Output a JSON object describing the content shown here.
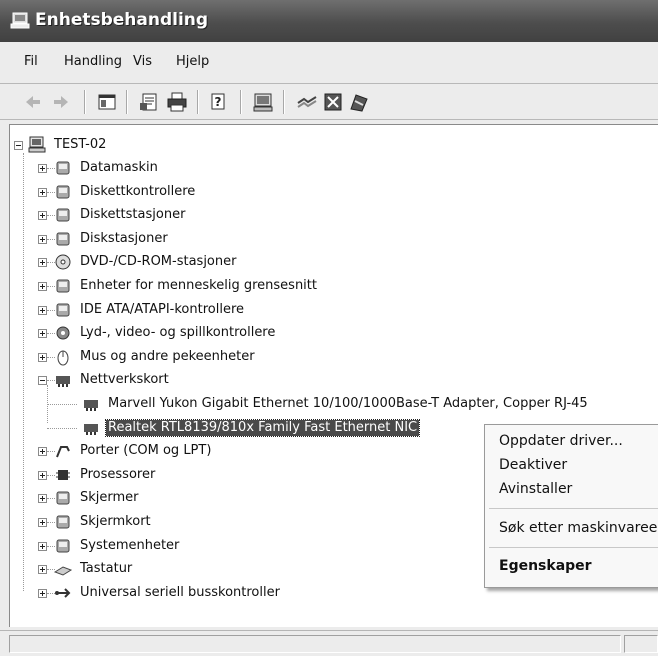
{
  "window": {
    "title": "Enhetsbehandling"
  },
  "menu": [
    "Fil",
    "Handling",
    "Vis",
    "Hjelp"
  ],
  "toolbar": [
    "back-icon",
    "forward-icon",
    "console-tree-icon",
    "properties-icon",
    "print-icon",
    "help-icon",
    "scan-hardware-icon",
    "update-driver-icon",
    "disable-icon",
    "uninstall-icon"
  ],
  "tree": {
    "root": "TEST-02",
    "categories": [
      "Datamaskin",
      "Diskettkontrollere",
      "Diskettstasjoner",
      "Diskstasjoner",
      "DVD-/CD-ROM-stasjoner",
      "Enheter for menneskelig grensesnitt",
      "IDE ATA/ATAPI-kontrollere",
      "Lyd-, video- og spillkontrollere",
      "Mus og andre pekeenheter",
      "Nettverkskort",
      "Porter (COM og LPT)",
      "Prosessorer",
      "Skjermer",
      "Skjermkort",
      "Systemenheter",
      "Tastatur",
      "Universal seriell busskontroller"
    ],
    "network_children": [
      "Marvell Yukon Gigabit Ethernet 10/100/1000Base-T Adapter, Copper RJ-45",
      "Realtek RTL8139/810x Family Fast Ethernet NIC"
    ],
    "selected": "Realtek RTL8139/810x Family Fast Ethernet NIC"
  },
  "context_menu": {
    "update_driver": "Oppdater driver...",
    "disable": "Deaktiver",
    "uninstall": "Avinstaller",
    "scan": "Søk etter maskinvareendringer",
    "properties": "Egenskaper"
  },
  "colors": {
    "titlebar": "#4d4d4d",
    "selection": "#4a4a4a",
    "background": "#ececec"
  }
}
